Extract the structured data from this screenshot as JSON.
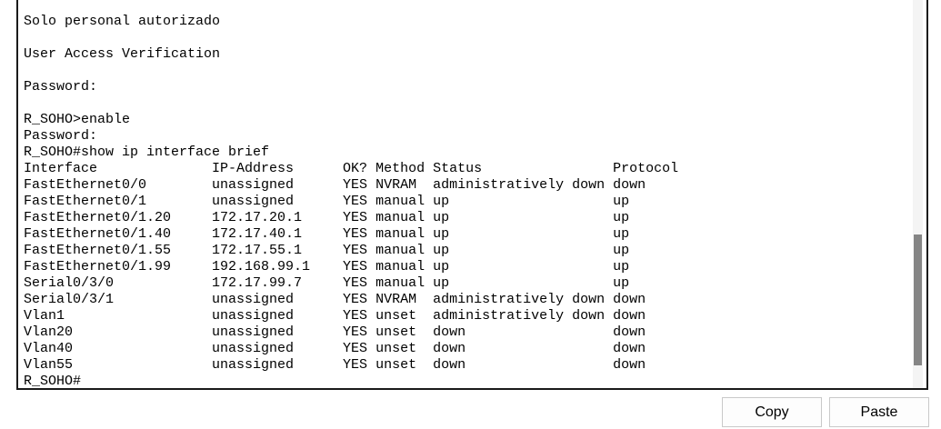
{
  "terminal": {
    "lines": [
      "Solo personal autorizado",
      "",
      "User Access Verification",
      "",
      "Password:",
      "",
      "R_SOHO>enable",
      "Password:",
      "R_SOHO#show ip interface brief",
      "Interface              IP-Address      OK? Method Status                Protocol",
      "FastEthernet0/0        unassigned      YES NVRAM  administratively down down",
      "FastEthernet0/1        unassigned      YES manual up                    up",
      "FastEthernet0/1.20     172.17.20.1     YES manual up                    up",
      "FastEthernet0/1.40     172.17.40.1     YES manual up                    up",
      "FastEthernet0/1.55     172.17.55.1     YES manual up                    up",
      "FastEthernet0/1.99     192.168.99.1    YES manual up                    up",
      "Serial0/3/0            172.17.99.7     YES manual up                    up",
      "Serial0/3/1            unassigned      YES NVRAM  administratively down down",
      "Vlan1                  unassigned      YES unset  administratively down down",
      "Vlan20                 unassigned      YES unset  down                  down",
      "Vlan40                 unassigned      YES unset  down                  down",
      "Vlan55                 unassigned      YES unset  down                  down",
      "R_SOHO#"
    ]
  },
  "buttons": {
    "copy_label": "Copy",
    "paste_label": "Paste"
  }
}
